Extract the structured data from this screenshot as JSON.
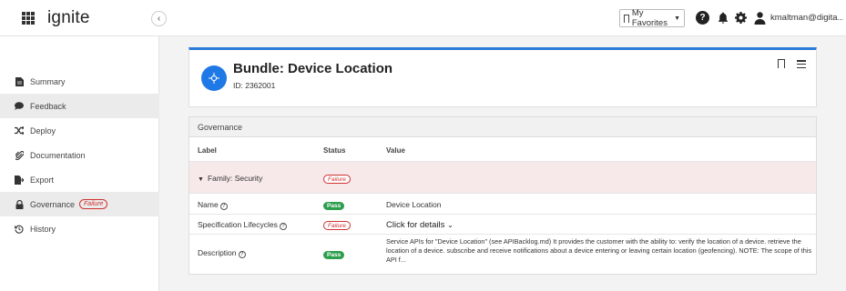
{
  "app": {
    "logo": "ignite"
  },
  "topbar": {
    "favorites_label": "My Favorites",
    "user_name": "kmaltman@digita..."
  },
  "sidebar": {
    "items": [
      {
        "label": "Summary",
        "icon": "document-icon"
      },
      {
        "label": "Feedback",
        "icon": "comment-icon"
      },
      {
        "label": "Deploy",
        "icon": "shuffle-icon"
      },
      {
        "label": "Documentation",
        "icon": "paperclip-icon"
      },
      {
        "label": "Export",
        "icon": "export-icon"
      },
      {
        "label": "Governance",
        "icon": "lock-icon",
        "badge": "Failure"
      },
      {
        "label": "History",
        "icon": "history-icon"
      }
    ]
  },
  "bundle": {
    "title": "Bundle: Device Location",
    "id": "ID: 2362001"
  },
  "governance": {
    "title": "Governance",
    "headers": {
      "label": "Label",
      "status": "Status",
      "value": "Value"
    },
    "family": {
      "label": "Family: Security",
      "status": "Failure"
    },
    "rows": [
      {
        "label": "Name",
        "status": "Pass",
        "value": "Device Location"
      },
      {
        "label": "Specification Lifecycles",
        "status": "Failure",
        "value": "Click for details"
      },
      {
        "label": "Description",
        "status": "Pass",
        "value": "Service APIs for \"Device Location\" (see APIBacklog.md) It provides the customer with the ability to: verify the location of a device. retrieve the location of a device. subscribe and receive notifications about a device entering or leaving certain location (geofencing). NOTE: The scope of this API f..."
      }
    ]
  },
  "colors": {
    "accent": "#2b7bd8",
    "failure": "#d03030",
    "pass": "#2e9e4f",
    "family_row": "#f7e9e9"
  }
}
